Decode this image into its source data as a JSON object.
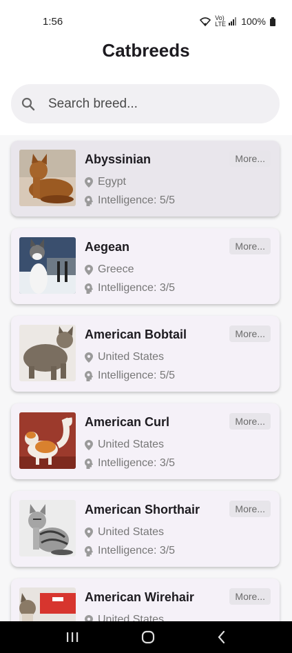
{
  "status": {
    "time": "1:56",
    "battery": "100%",
    "network": "Vo) LTE"
  },
  "header": {
    "title": "Catbreeds"
  },
  "search": {
    "placeholder": "Search breed..."
  },
  "breeds": [
    {
      "name": "Abyssinian",
      "origin": "Egypt",
      "intelligence": "Intelligence: 5/5",
      "more": "More..."
    },
    {
      "name": "Aegean",
      "origin": "Greece",
      "intelligence": "Intelligence: 3/5",
      "more": "More..."
    },
    {
      "name": "American Bobtail",
      "origin": "United States",
      "intelligence": "Intelligence: 5/5",
      "more": "More..."
    },
    {
      "name": "American Curl",
      "origin": "United States",
      "intelligence": "Intelligence: 3/5",
      "more": "More..."
    },
    {
      "name": "American Shorthair",
      "origin": "United States",
      "intelligence": "Intelligence: 3/5",
      "more": "More..."
    },
    {
      "name": "American Wirehair",
      "origin": "United States",
      "intelligence": "",
      "more": "More..."
    }
  ],
  "colors": {
    "card": "#f5f1f8",
    "card_selected": "#e9e6ec",
    "search_bg": "#f1f0f3"
  }
}
